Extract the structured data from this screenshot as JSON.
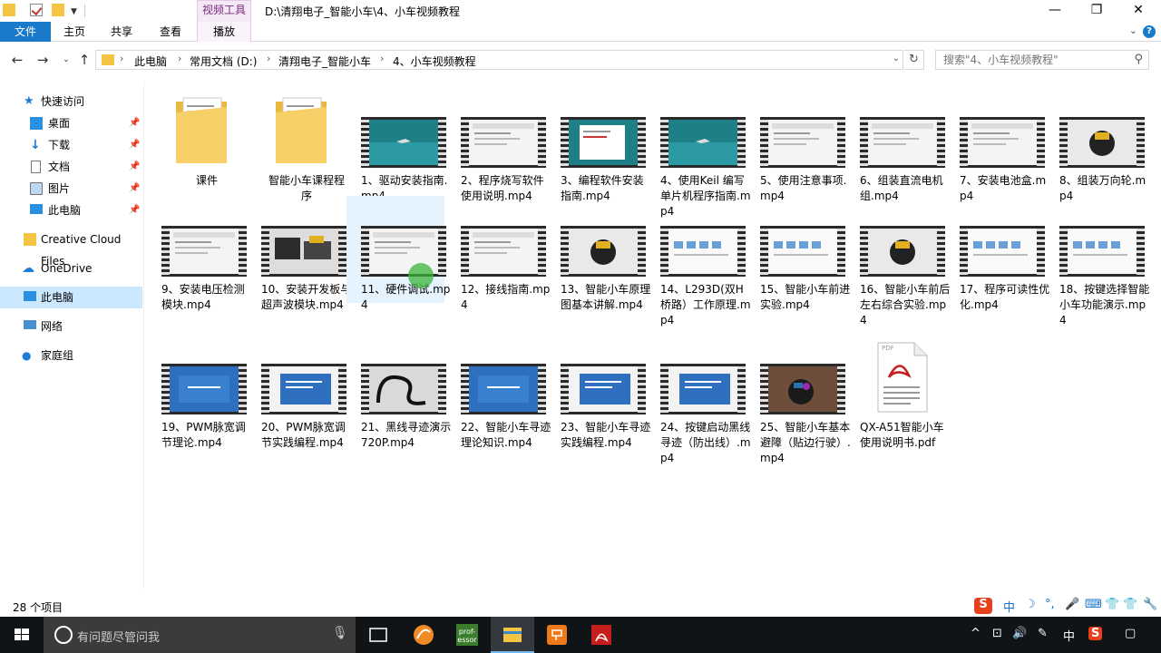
{
  "titlebar": {
    "context_tab": "视频工具",
    "title": "D:\\清翔电子_智能小车\\4、小车视频教程",
    "minimize": "—",
    "restore": "❐",
    "close": "✕"
  },
  "ribbon": {
    "tabs": [
      "文件",
      "主页",
      "共享",
      "查看",
      "播放"
    ],
    "help": "?"
  },
  "address": {
    "crumbs": [
      "此电脑",
      "常用文档 (D:)",
      "清翔电子_智能小车",
      "4、小车视频教程"
    ],
    "search_placeholder": "搜索\"4、小车视频教程\""
  },
  "sidebar": {
    "items": [
      {
        "label": "快速访问",
        "icon": "star-icon"
      },
      {
        "label": "桌面",
        "icon": "desktop-icon"
      },
      {
        "label": "下载",
        "icon": "download-icon"
      },
      {
        "label": "文档",
        "icon": "document-icon"
      },
      {
        "label": "图片",
        "icon": "picture-icon"
      },
      {
        "label": "此电脑",
        "icon": "computer-icon"
      },
      {
        "label": "Creative Cloud Files",
        "icon": "folder-icon"
      },
      {
        "label": "OneDrive",
        "icon": "cloud-icon"
      },
      {
        "label": "此电脑",
        "icon": "computer-icon"
      },
      {
        "label": "网络",
        "icon": "network-icon"
      },
      {
        "label": "家庭组",
        "icon": "homegroup-icon"
      }
    ]
  },
  "files": [
    {
      "name": "课件",
      "type": "folder"
    },
    {
      "name": "智能小车课程程序",
      "type": "folder"
    },
    {
      "name": "1、驱动安装指南.mp4",
      "type": "video",
      "thumb": "ocean"
    },
    {
      "name": "2、程序烧写软件使用说明.mp4",
      "type": "video",
      "thumb": "window"
    },
    {
      "name": "3、编程软件安装指南.mp4",
      "type": "video",
      "thumb": "dialog"
    },
    {
      "name": "4、使用Keil 编写单片机程序指南.mp4",
      "type": "video",
      "thumb": "ocean"
    },
    {
      "name": "5、使用注意事项.mp4",
      "type": "video",
      "thumb": "window"
    },
    {
      "name": "6、组装直流电机组.mp4",
      "type": "video",
      "thumb": "window"
    },
    {
      "name": "7、安装电池盒.mp4",
      "type": "video",
      "thumb": "window"
    },
    {
      "name": "8、组装万向轮.mp4",
      "type": "video",
      "thumb": "robot"
    },
    {
      "name": "9、安装电压检测模块.mp4",
      "type": "video",
      "thumb": "window"
    },
    {
      "name": "10、安装开发板与超声波模块.mp4",
      "type": "video",
      "thumb": "board"
    },
    {
      "name": "11、硬件调试.mp4",
      "type": "video",
      "thumb": "window"
    },
    {
      "name": "12、接线指南.mp4",
      "type": "video",
      "thumb": "window"
    },
    {
      "name": "13、智能小车原理图基本讲解.mp4",
      "type": "video",
      "thumb": "robot"
    },
    {
      "name": "14、L293D(双H桥路）工作原理.mp4",
      "type": "video",
      "thumb": "schematic"
    },
    {
      "name": "15、智能小车前进实验.mp4",
      "type": "video",
      "thumb": "schematic"
    },
    {
      "name": "16、智能小车前后左右综合实验.mp4",
      "type": "video",
      "thumb": "robot"
    },
    {
      "name": "17、程序可读性优化.mp4",
      "type": "video",
      "thumb": "schematic"
    },
    {
      "name": "18、按键选择智能小车功能演示.mp4",
      "type": "video",
      "thumb": "schematic"
    },
    {
      "name": "19、PWM脉宽调节理论.mp4",
      "type": "video",
      "thumb": "blue"
    },
    {
      "name": "20、PWM脉宽调节实践编程.mp4",
      "type": "video",
      "thumb": "bluewin"
    },
    {
      "name": "21、黑线寻迹演示720P.mp4",
      "type": "video",
      "thumb": "track"
    },
    {
      "name": "22、智能小车寻迹理论知识.mp4",
      "type": "video",
      "thumb": "blue"
    },
    {
      "name": "23、智能小车寻迹实践编程.mp4",
      "type": "video",
      "thumb": "bluewin"
    },
    {
      "name": "24、按键启动黑线寻迹（防出线）.mp4",
      "type": "video",
      "thumb": "bluewin"
    },
    {
      "name": "25、智能小车基本避障（贴边行驶）.mp4",
      "type": "video",
      "thumb": "car"
    },
    {
      "name": "QX-A51智能小车使用说明书.pdf",
      "type": "pdf"
    }
  ],
  "status": {
    "item_count": "28 个项目"
  },
  "ime": {
    "items": [
      "S",
      "中",
      "☽",
      "°,",
      "🎤",
      "⌨",
      "👕",
      "👕",
      "🔧"
    ]
  },
  "taskbar": {
    "search_text": "有问题尽管问我",
    "apps": [
      {
        "icon": "task-view-icon",
        "label": ""
      },
      {
        "icon": "app-orange-icon",
        "label": ""
      },
      {
        "icon": "professor-icon",
        "label": "prof-\nessor"
      },
      {
        "icon": "file-explorer-icon",
        "label": ""
      },
      {
        "icon": "presentation-icon",
        "label": ""
      },
      {
        "icon": "acrobat-icon",
        "label": ""
      }
    ],
    "tray": [
      "^",
      "⊡",
      "🔊",
      "✎",
      "中",
      "S",
      "▢"
    ]
  }
}
